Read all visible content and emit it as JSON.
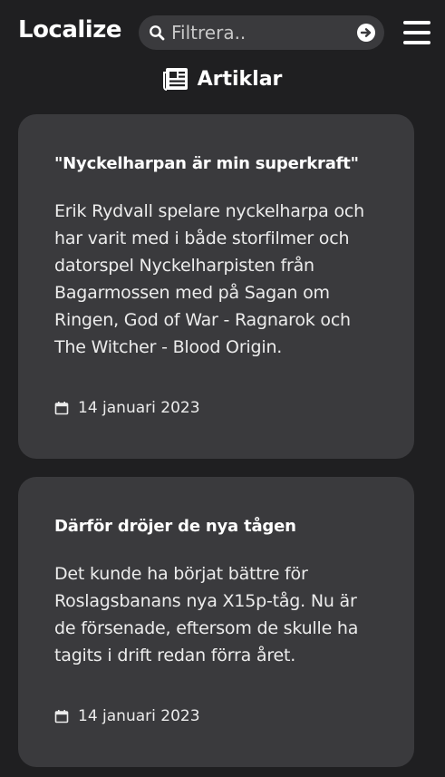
{
  "header": {
    "logo": "Localize",
    "search": {
      "placeholder": "Filtrera.."
    }
  },
  "section": {
    "title": "Artiklar",
    "icon": "newspaper-icon"
  },
  "articles": [
    {
      "title": "\"Nyckelharpan är min superkraft\"",
      "text": "Erik Rydvall spelare nyckelharpa och har varit med i både storfilmer och datorspel Nyckelharpisten från Bagarmossen med på Sagan om Ringen, God of War - Ragnarok och The Witcher - Blood Origin.",
      "date": "14 januari 2023"
    },
    {
      "title": "Därför dröjer de nya tågen",
      "text": "Det kunde ha börjat bättre för Roslagsbanans nya X15p-tåg. Nu är de försenade, eftersom de skulle ha tagits i drift redan förra året.",
      "date": "14 januari 2023"
    }
  ],
  "colors": {
    "background": "#1f1f21",
    "card": "#3a3a3d",
    "text": "#f0f0f0"
  }
}
